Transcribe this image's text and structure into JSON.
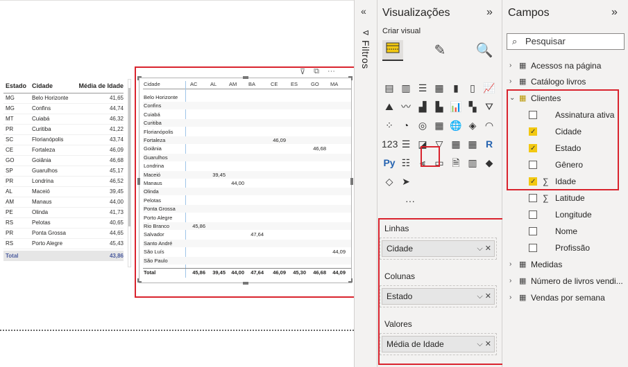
{
  "table1": {
    "headers": [
      "Estado",
      "Cidade",
      "Média de Idade"
    ],
    "rows": [
      [
        "MG",
        "Belo Horizonte",
        "41,65"
      ],
      [
        "MG",
        "Confins",
        "44,74"
      ],
      [
        "MT",
        "Cuiabá",
        "46,32"
      ],
      [
        "PR",
        "Curitiba",
        "41,22"
      ],
      [
        "SC",
        "Florianópolis",
        "43,74"
      ],
      [
        "CE",
        "Fortaleza",
        "46,09"
      ],
      [
        "GO",
        "Goiânia",
        "46,68"
      ],
      [
        "SP",
        "Guarulhos",
        "45,17"
      ],
      [
        "PR",
        "Londrina",
        "46,52"
      ],
      [
        "AL",
        "Maceió",
        "39,45"
      ],
      [
        "AM",
        "Manaus",
        "44,00"
      ],
      [
        "PE",
        "Olinda",
        "41,73"
      ],
      [
        "RS",
        "Pelotas",
        "40,65"
      ],
      [
        "PR",
        "Ponta Grossa",
        "44,65"
      ],
      [
        "RS",
        "Porto Alegre",
        "45,43"
      ]
    ],
    "total_label": "Total",
    "total_value": "43,86"
  },
  "matrix": {
    "row_header": "Cidade",
    "columns": [
      "AC",
      "AL",
      "AM",
      "BA",
      "CE",
      "ES",
      "GO",
      "MA"
    ],
    "rows": [
      {
        "label": "Belo Horizonte",
        "cells": [
          "",
          "",
          "",
          "",
          "",
          "",
          "",
          ""
        ]
      },
      {
        "label": "Confins",
        "cells": [
          "",
          "",
          "",
          "",
          "",
          "",
          "",
          ""
        ]
      },
      {
        "label": "Cuiabá",
        "cells": [
          "",
          "",
          "",
          "",
          "",
          "",
          "",
          ""
        ]
      },
      {
        "label": "Curitiba",
        "cells": [
          "",
          "",
          "",
          "",
          "",
          "",
          "",
          ""
        ]
      },
      {
        "label": "Florianópolis",
        "cells": [
          "",
          "",
          "",
          "",
          "",
          "",
          "",
          ""
        ]
      },
      {
        "label": "Fortaleza",
        "cells": [
          "",
          "",
          "",
          "",
          "46,09",
          "",
          "",
          ""
        ]
      },
      {
        "label": "Goiânia",
        "cells": [
          "",
          "",
          "",
          "",
          "",
          "",
          "46,68",
          ""
        ]
      },
      {
        "label": "Guarulhos",
        "cells": [
          "",
          "",
          "",
          "",
          "",
          "",
          "",
          ""
        ]
      },
      {
        "label": "Londrina",
        "cells": [
          "",
          "",
          "",
          "",
          "",
          "",
          "",
          ""
        ]
      },
      {
        "label": "Maceió",
        "cells": [
          "",
          "39,45",
          "",
          "",
          "",
          "",
          "",
          ""
        ]
      },
      {
        "label": "Manaus",
        "cells": [
          "",
          "",
          "44,00",
          "",
          "",
          "",
          "",
          ""
        ]
      },
      {
        "label": "Olinda",
        "cells": [
          "",
          "",
          "",
          "",
          "",
          "",
          "",
          ""
        ]
      },
      {
        "label": "Pelotas",
        "cells": [
          "",
          "",
          "",
          "",
          "",
          "",
          "",
          ""
        ]
      },
      {
        "label": "Ponta Grossa",
        "cells": [
          "",
          "",
          "",
          "",
          "",
          "",
          "",
          ""
        ]
      },
      {
        "label": "Porto Alegre",
        "cells": [
          "",
          "",
          "",
          "",
          "",
          "",
          "",
          ""
        ]
      },
      {
        "label": "Rio Branco",
        "cells": [
          "45,86",
          "",
          "",
          "",
          "",
          "",
          "",
          ""
        ]
      },
      {
        "label": "Salvador",
        "cells": [
          "",
          "",
          "",
          "47,64",
          "",
          "",
          "",
          ""
        ]
      },
      {
        "label": "Santo André",
        "cells": [
          "",
          "",
          "",
          "",
          "",
          "",
          "",
          ""
        ]
      },
      {
        "label": "São Luís",
        "cells": [
          "",
          "",
          "",
          "",
          "",
          "",
          "",
          "44,09"
        ]
      },
      {
        "label": "São Paulo",
        "cells": [
          "",
          "",
          "",
          "",
          "",
          "",
          "",
          ""
        ]
      }
    ],
    "total_label": "Total",
    "totals": [
      "45,86",
      "39,45",
      "44,00",
      "47,64",
      "46,09",
      "45,30",
      "46,68",
      "44,09"
    ]
  },
  "filters": {
    "label": "Filtros"
  },
  "viz": {
    "title": "Visualizações",
    "subtitle": "Criar visual",
    "more": "···",
    "wells": {
      "rows_label": "Linhas",
      "rows_field": "Cidade",
      "cols_label": "Colunas",
      "cols_field": "Estado",
      "values_label": "Valores",
      "values_field": "Média de Idade"
    }
  },
  "fields": {
    "title": "Campos",
    "search_placeholder": "Pesquisar",
    "tables_top": [
      "Acessos na página",
      "Catálogo livros"
    ],
    "clientes": "Clientes",
    "clientes_fields": [
      {
        "name": "Assinatura ativa",
        "checked": false,
        "sigma": false
      },
      {
        "name": "Cidade",
        "checked": true,
        "sigma": false
      },
      {
        "name": "Estado",
        "checked": true,
        "sigma": false
      },
      {
        "name": "Gênero",
        "checked": false,
        "sigma": false
      },
      {
        "name": "Idade",
        "checked": true,
        "sigma": true
      },
      {
        "name": "Latitude",
        "checked": false,
        "sigma": true
      },
      {
        "name": "Longitude",
        "checked": false,
        "sigma": false
      },
      {
        "name": "Nome",
        "checked": false,
        "sigma": false
      },
      {
        "name": "Profissão",
        "checked": false,
        "sigma": false
      }
    ],
    "tables_bottom": [
      "Medidas",
      "Número de livros vendi...",
      "Vendas por semana"
    ]
  },
  "colors": {
    "accent_red": "#d9232d",
    "check_yellow": "#f2c811",
    "total_blue": "#4a5b9e"
  }
}
